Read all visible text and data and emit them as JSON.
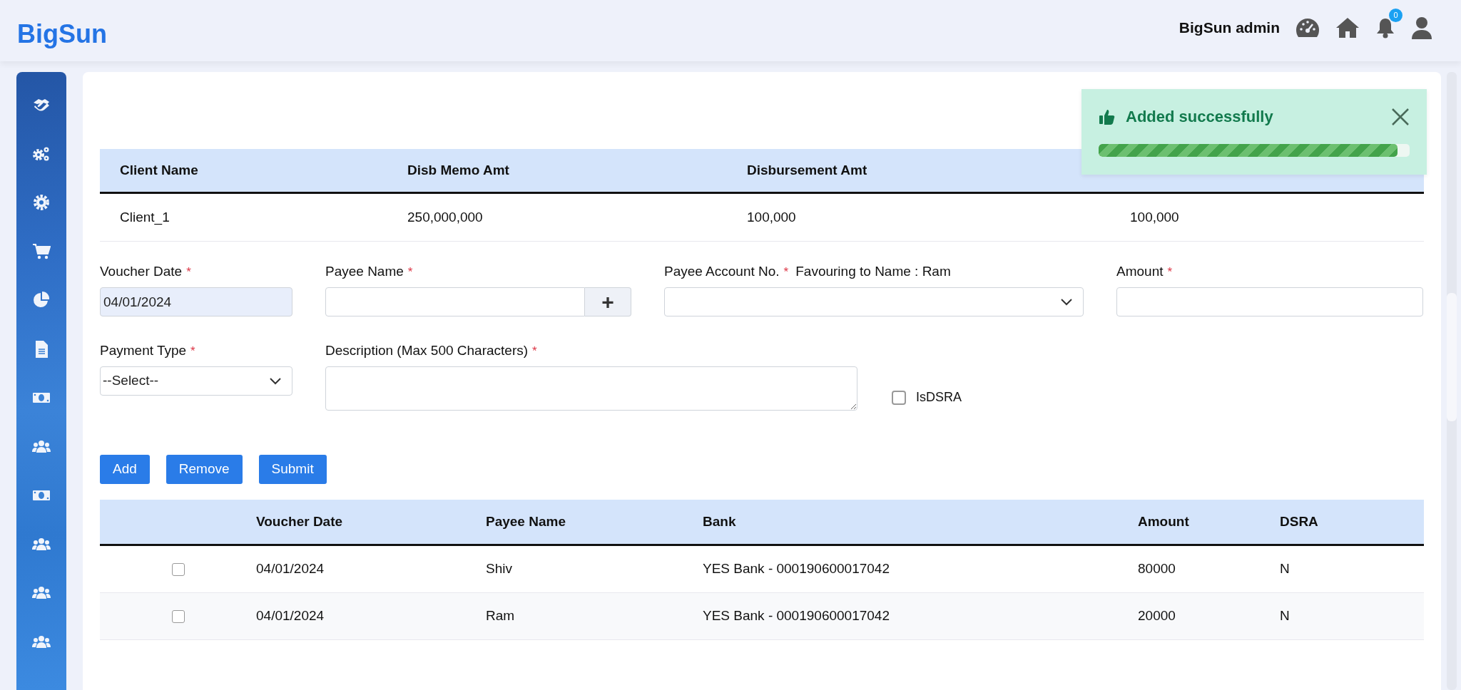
{
  "brand": "BigSun",
  "header": {
    "user": "BigSun admin",
    "notification_count": "0"
  },
  "sidebar": {
    "items": [
      {
        "kind": "handshake"
      },
      {
        "kind": "gears"
      },
      {
        "kind": "gear"
      },
      {
        "kind": "cart"
      },
      {
        "kind": "pie"
      },
      {
        "kind": "document"
      },
      {
        "kind": "money"
      },
      {
        "kind": "users"
      },
      {
        "kind": "money"
      },
      {
        "kind": "users"
      },
      {
        "kind": "users"
      },
      {
        "kind": "users"
      }
    ]
  },
  "toast": {
    "message": "Added successfully",
    "level": 0.96
  },
  "summary_table": {
    "columns": [
      "Client Name",
      "Disb Memo Amt",
      "Disbursement Amt"
    ],
    "rows": [
      [
        "Client_1",
        "250,000,000",
        "100,000",
        "100,000"
      ]
    ]
  },
  "form": {
    "rows": [
      [
        {
          "kind": "date",
          "label": "Voucher Date",
          "asterisk": "*",
          "value": "04/01/2024"
        },
        {
          "kind": "text-add",
          "label": "Payee Name",
          "asterisk": "*",
          "add": "+"
        },
        {
          "kind": "select",
          "label": "Payee Account No.",
          "asterisk": "*",
          "note": "Favouring to Name : Ram"
        },
        {
          "kind": "text",
          "label": "Amount",
          "asterisk": "*"
        }
      ],
      [
        {
          "kind": "select",
          "label": "Payment Type",
          "asterisk": "*",
          "value": "--Select--"
        },
        {
          "kind": "textarea",
          "label": "Description (Max 500 Characters)",
          "asterisk": "*"
        },
        {
          "kind": "checkbox",
          "label": "IsDSRA",
          "checked": false
        }
      ]
    ]
  },
  "buttons": [
    "Add",
    "Remove",
    "Submit"
  ],
  "entries_table": {
    "columns": [
      "Voucher Date",
      "Payee Name",
      "Bank",
      "Amount",
      "DSRA"
    ],
    "rows": [
      {
        "checked": false,
        "cells": [
          "04/01/2024",
          "Shiv",
          "YES Bank - 000190600017042",
          "80000",
          "N"
        ]
      },
      {
        "checked": false,
        "cells": [
          "04/01/2024",
          "Ram",
          "YES Bank - 000190600017042",
          "20000",
          "N"
        ]
      }
    ]
  }
}
